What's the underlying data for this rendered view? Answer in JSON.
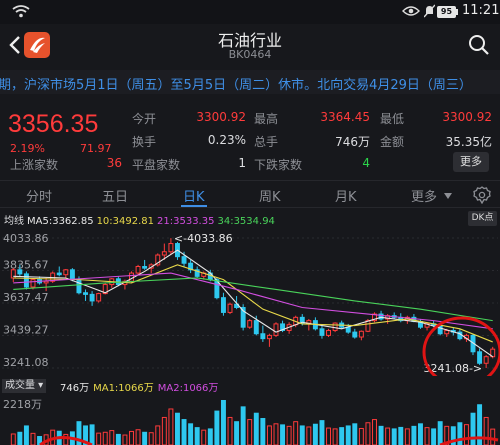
{
  "status": {
    "battery": "95",
    "time": "11:21"
  },
  "header": {
    "title": "石油行业",
    "code": "BK0464"
  },
  "notice": "期，沪深市场5月1日（周五）至5月5日（周二）休市。北向交易4月29日（周三）",
  "quote": {
    "price": "3356.35",
    "pct": "2.19%",
    "change": "71.97",
    "rows": [
      [
        {
          "label": "今开",
          "value": "3300.92",
          "color": "red"
        },
        {
          "label": "最高",
          "value": "3364.45",
          "color": "red"
        },
        {
          "label": "最低",
          "value": "3300.92",
          "color": "red"
        }
      ],
      [
        {
          "label": "换手",
          "value": "0.23%",
          "color": "white"
        },
        {
          "label": "总手",
          "value": "746万",
          "color": "white"
        },
        {
          "label": "金额",
          "value": "35.35亿",
          "color": "white"
        }
      ],
      [
        {
          "label": "上涨家数",
          "value": "36",
          "color": "red"
        },
        {
          "label": "平盘家数",
          "value": "1",
          "color": "white"
        },
        {
          "label": "下跌家数",
          "value": "4",
          "color": "green"
        }
      ]
    ],
    "more_label": "更多"
  },
  "tabs": {
    "items": [
      "分时",
      "五日",
      "日K",
      "周K",
      "月K",
      "更多"
    ],
    "active": 2
  },
  "ma_legend": {
    "prefix": "均线",
    "items": [
      {
        "text": "MA5:3362.85",
        "color": "#e8e8e8"
      },
      {
        "text": "10:3492.81",
        "color": "#e8d84a"
      },
      {
        "text": "21:3533.35",
        "color": "#d24ee0"
      },
      {
        "text": "34:3534.94",
        "color": "#49d35a"
      }
    ],
    "dk_label": "DK点"
  },
  "chart_data": {
    "type": "candlestick",
    "y_ticks": [
      "4033.86",
      "3835.67",
      "3637.47",
      "3439.27",
      "3241.08"
    ],
    "ylim": [
      3241.08,
      4033.86
    ],
    "annotations": {
      "high": "<-4033.86",
      "low": "3241.08->"
    },
    "candles": [
      [
        3790,
        3850,
        3765,
        3840
      ],
      [
        3840,
        3870,
        3800,
        3815
      ],
      [
        3815,
        3830,
        3720,
        3735
      ],
      [
        3735,
        3790,
        3720,
        3780
      ],
      [
        3780,
        3800,
        3750,
        3760
      ],
      [
        3760,
        3790,
        3710,
        3770
      ],
      [
        3770,
        3830,
        3760,
        3820
      ],
      [
        3820,
        3860,
        3800,
        3810
      ],
      [
        3810,
        3845,
        3790,
        3840
      ],
      [
        3840,
        3850,
        3770,
        3780
      ],
      [
        3780,
        3800,
        3690,
        3700
      ],
      [
        3700,
        3720,
        3650,
        3690
      ],
      [
        3690,
        3710,
        3620,
        3650
      ],
      [
        3650,
        3700,
        3640,
        3695
      ],
      [
        3695,
        3760,
        3690,
        3750
      ],
      [
        3750,
        3790,
        3730,
        3785
      ],
      [
        3785,
        3800,
        3740,
        3750
      ],
      [
        3750,
        3780,
        3720,
        3770
      ],
      [
        3770,
        3830,
        3760,
        3820
      ],
      [
        3820,
        3870,
        3810,
        3860
      ],
      [
        3860,
        3900,
        3840,
        3850
      ],
      [
        3850,
        3880,
        3820,
        3870
      ],
      [
        3870,
        3940,
        3860,
        3930
      ],
      [
        3930,
        4000,
        3900,
        3950
      ],
      [
        3950,
        4033,
        3930,
        4000
      ],
      [
        4000,
        4010,
        3900,
        3920
      ],
      [
        3920,
        3950,
        3860,
        3880
      ],
      [
        3880,
        3900,
        3820,
        3840
      ],
      [
        3840,
        3860,
        3790,
        3800
      ],
      [
        3800,
        3830,
        3780,
        3820
      ],
      [
        3820,
        3840,
        3770,
        3780
      ],
      [
        3780,
        3790,
        3660,
        3670
      ],
      [
        3670,
        3700,
        3560,
        3580
      ],
      [
        3580,
        3640,
        3570,
        3630
      ],
      [
        3630,
        3680,
        3600,
        3610
      ],
      [
        3610,
        3630,
        3470,
        3490
      ],
      [
        3490,
        3540,
        3480,
        3530
      ],
      [
        3530,
        3560,
        3440,
        3450
      ],
      [
        3450,
        3500,
        3400,
        3420
      ],
      [
        3420,
        3450,
        3370,
        3440
      ],
      [
        3440,
        3520,
        3430,
        3510
      ],
      [
        3510,
        3530,
        3460,
        3470
      ],
      [
        3470,
        3520,
        3450,
        3505
      ],
      [
        3505,
        3560,
        3490,
        3550
      ],
      [
        3550,
        3570,
        3500,
        3515
      ],
      [
        3515,
        3540,
        3470,
        3530
      ],
      [
        3530,
        3550,
        3470,
        3480
      ],
      [
        3480,
        3500,
        3420,
        3440
      ],
      [
        3440,
        3480,
        3430,
        3470
      ],
      [
        3470,
        3520,
        3460,
        3515
      ],
      [
        3515,
        3530,
        3480,
        3490
      ],
      [
        3490,
        3510,
        3450,
        3460
      ],
      [
        3460,
        3480,
        3420,
        3430
      ],
      [
        3430,
        3470,
        3410,
        3465
      ],
      [
        3465,
        3540,
        3460,
        3530
      ],
      [
        3530,
        3580,
        3520,
        3570
      ],
      [
        3570,
        3590,
        3530,
        3540
      ],
      [
        3540,
        3570,
        3510,
        3560
      ],
      [
        3560,
        3580,
        3540,
        3550
      ],
      [
        3550,
        3575,
        3520,
        3530
      ],
      [
        3530,
        3560,
        3510,
        3550
      ],
      [
        3550,
        3570,
        3520,
        3525
      ],
      [
        3525,
        3540,
        3480,
        3490
      ],
      [
        3490,
        3520,
        3470,
        3510
      ],
      [
        3510,
        3530,
        3490,
        3500
      ],
      [
        3500,
        3510,
        3440,
        3450
      ],
      [
        3450,
        3480,
        3430,
        3470
      ],
      [
        3470,
        3490,
        3440,
        3460
      ],
      [
        3460,
        3480,
        3410,
        3420
      ],
      [
        3420,
        3450,
        3400,
        3440
      ],
      [
        3440,
        3450,
        3320,
        3340
      ],
      [
        3340,
        3360,
        3260,
        3270
      ],
      [
        3270,
        3320,
        3241,
        3310
      ],
      [
        3310,
        3370,
        3300,
        3356
      ]
    ],
    "ma_series": [
      {
        "name": "MA5",
        "color": "#e8e8e8",
        "values": [
          [
            0,
            3800
          ],
          [
            8,
            3790
          ],
          [
            14,
            3700
          ],
          [
            20,
            3830
          ],
          [
            25,
            3960
          ],
          [
            30,
            3820
          ],
          [
            35,
            3590
          ],
          [
            40,
            3460
          ],
          [
            44,
            3520
          ],
          [
            50,
            3480
          ],
          [
            56,
            3550
          ],
          [
            62,
            3520
          ],
          [
            68,
            3450
          ],
          [
            73,
            3310
          ]
        ]
      },
      {
        "name": "MA10",
        "color": "#e8d84a",
        "values": [
          [
            0,
            3790
          ],
          [
            10,
            3780
          ],
          [
            18,
            3760
          ],
          [
            25,
            3870
          ],
          [
            32,
            3780
          ],
          [
            38,
            3600
          ],
          [
            44,
            3510
          ],
          [
            52,
            3500
          ],
          [
            60,
            3540
          ],
          [
            68,
            3480
          ],
          [
            73,
            3400
          ]
        ]
      },
      {
        "name": "MA21",
        "color": "#d24ee0",
        "values": [
          [
            0,
            3760
          ],
          [
            12,
            3790
          ],
          [
            24,
            3820
          ],
          [
            34,
            3720
          ],
          [
            44,
            3610
          ],
          [
            54,
            3570
          ],
          [
            64,
            3530
          ],
          [
            73,
            3480
          ]
        ]
      },
      {
        "name": "MA34",
        "color": "#49d35a",
        "values": [
          [
            0,
            3720
          ],
          [
            14,
            3760
          ],
          [
            28,
            3790
          ],
          [
            40,
            3720
          ],
          [
            52,
            3650
          ],
          [
            62,
            3600
          ],
          [
            73,
            3530
          ]
        ]
      }
    ]
  },
  "volume": {
    "tag": "成交量",
    "items": [
      {
        "text": "746万",
        "color": "#e8e8e8"
      },
      {
        "text": "MA1:1066万",
        "color": "#e8d84a"
      },
      {
        "text": "MA2:1066万",
        "color": "#d24ee0"
      }
    ],
    "y_label": "2218万",
    "max": 2218,
    "bars": [
      520,
      600,
      900,
      550,
      400,
      480,
      700,
      650,
      500,
      620,
      1100,
      900,
      950,
      560,
      600,
      680,
      500,
      470,
      640,
      720,
      600,
      580,
      900,
      1300,
      1700,
      1500,
      1200,
      1000,
      820,
      700,
      760,
      1600,
      2100,
      1300,
      1100,
      1800,
      1200,
      1500,
      1250,
      900,
      1000,
      950,
      880,
      1100,
      900,
      850,
      980,
      1150,
      800,
      760,
      820,
      900,
      1000,
      780,
      1050,
      1200,
      880,
      800,
      760,
      830,
      760,
      880,
      1000,
      820,
      760,
      1100,
      880,
      860,
      1050,
      960,
      1500,
      1900,
      1300,
      750
    ]
  }
}
